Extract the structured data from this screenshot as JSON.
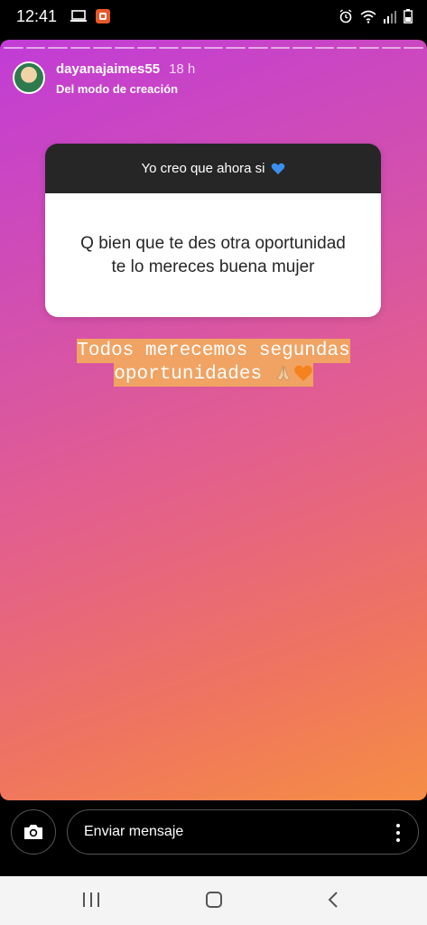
{
  "status_bar": {
    "time": "12:41"
  },
  "story": {
    "username": "dayanajaimes55",
    "time_ago": "18 h",
    "subtitle": "Del modo de creación",
    "question": {
      "prompt": "Yo creo que ahora si",
      "answer": "Q bien que te des otra oportunidad te lo mereces buena mujer"
    },
    "caption": "Todos merecemos segundas oportunidades",
    "progress_segments": 19
  },
  "reply": {
    "placeholder": "Enviar mensaje"
  },
  "colors": {
    "gradient_top": "#c13cd6",
    "gradient_bottom": "#f58d44",
    "caption_highlight": "#f0a363",
    "card_header": "#262626"
  },
  "icons": {
    "status_left": [
      "laptop-icon",
      "app-notification-icon"
    ],
    "status_right": [
      "alarm-icon",
      "wifi-icon",
      "signal-icon",
      "battery-icon"
    ],
    "reply": [
      "camera-icon",
      "more-options-icon"
    ],
    "nav": [
      "recent-apps-icon",
      "home-icon",
      "back-icon"
    ]
  }
}
